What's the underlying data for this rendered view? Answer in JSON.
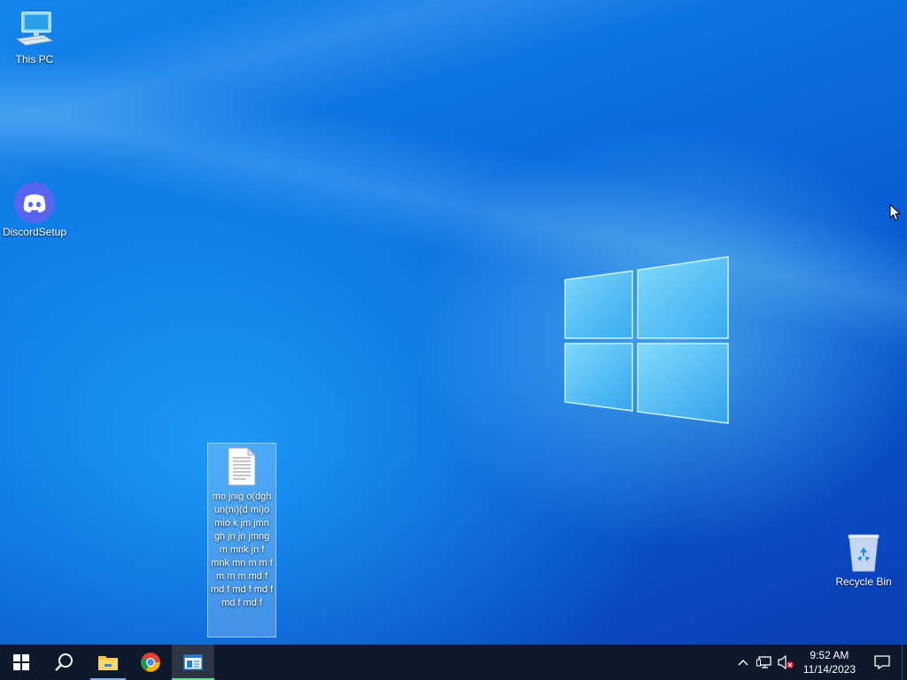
{
  "desktop": {
    "icons": [
      {
        "label": "This PC",
        "icon": "this-pc-icon"
      },
      {
        "label": "DiscordSetup",
        "icon": "discord-icon"
      },
      {
        "label": "Recycle Bin",
        "icon": "recycle-bin-icon"
      }
    ],
    "selected_file": {
      "label": "mo jnig o(dgh un(ni)(d mi)o mio k jm jmn gh jn jn jmng m mnk jn f mnk mn m m f m m m md f md f md f md f md f md f",
      "icon": "text-document-icon"
    }
  },
  "taskbar": {
    "start": "windows-start-icon",
    "search": "search-icon",
    "apps": [
      {
        "name": "File Explorer",
        "icon": "file-explorer-icon",
        "running": true
      },
      {
        "name": "Google Chrome",
        "icon": "chrome-icon",
        "running": false
      },
      {
        "name": "Window",
        "icon": "app-window-icon",
        "active": true
      }
    ],
    "tray": {
      "chevron": "chevron-up-icon",
      "network": "network-icon",
      "volume": "volume-muted-icon",
      "time": "9:52 AM",
      "date": "11/14/2023",
      "notifications": "notification-icon"
    }
  }
}
